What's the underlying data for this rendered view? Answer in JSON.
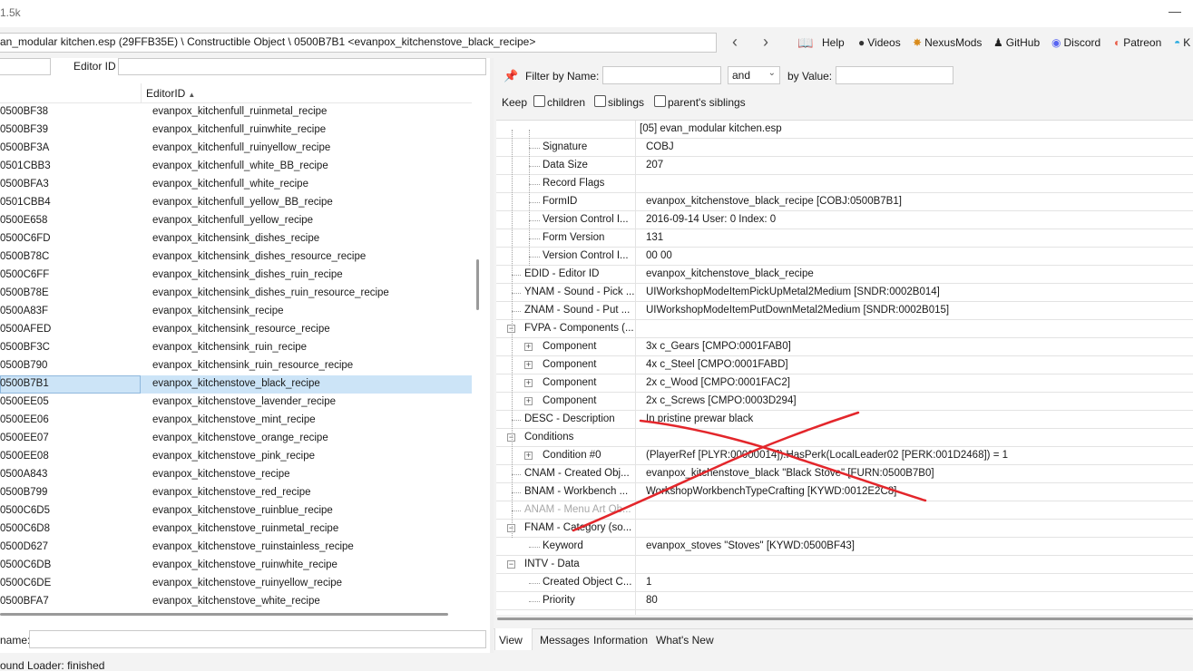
{
  "titlebar": {
    "title": "1.5k",
    "minimize": "—"
  },
  "path": {
    "text": "an_modular kitchen.esp (29FFB35E) \\ Constructible Object \\ 0500B7B1 <evanpox_kitchenstove_black_recipe>"
  },
  "nav": {
    "back": "‹",
    "forward": "›"
  },
  "toolbar_links": [
    {
      "label": "Help",
      "icon": "book-icon",
      "glyph": "📖"
    },
    {
      "label": "Videos",
      "icon": "videos-icon",
      "glyph": "●"
    },
    {
      "label": "NexusMods",
      "icon": "nexusmods-icon",
      "glyph": "✸"
    },
    {
      "label": "GitHub",
      "icon": "github-icon",
      "glyph": "♟"
    },
    {
      "label": "Discord",
      "icon": "discord-icon",
      "glyph": "◉"
    },
    {
      "label": "Patreon",
      "icon": "patreon-icon",
      "glyph": "◐"
    },
    {
      "label": "K",
      "icon": "kofi-icon",
      "glyph": "◓"
    }
  ],
  "left": {
    "editor_id_label": "Editor ID",
    "column_editor_id": "EditorID",
    "name_label": "name:",
    "rows": [
      {
        "formid": "0500BF38",
        "editorid": "evanpox_kitchenfull_ruinmetal_recipe"
      },
      {
        "formid": "0500BF39",
        "editorid": "evanpox_kitchenfull_ruinwhite_recipe"
      },
      {
        "formid": "0500BF3A",
        "editorid": "evanpox_kitchenfull_ruinyellow_recipe"
      },
      {
        "formid": "0501CBB3",
        "editorid": "evanpox_kitchenfull_white_BB_recipe"
      },
      {
        "formid": "0500BFA3",
        "editorid": "evanpox_kitchenfull_white_recipe"
      },
      {
        "formid": "0501CBB4",
        "editorid": "evanpox_kitchenfull_yellow_BB_recipe"
      },
      {
        "formid": "0500E658",
        "editorid": "evanpox_kitchenfull_yellow_recipe"
      },
      {
        "formid": "0500C6FD",
        "editorid": "evanpox_kitchensink_dishes_recipe"
      },
      {
        "formid": "0500B78C",
        "editorid": "evanpox_kitchensink_dishes_resource_recipe"
      },
      {
        "formid": "0500C6FF",
        "editorid": "evanpox_kitchensink_dishes_ruin_recipe"
      },
      {
        "formid": "0500B78E",
        "editorid": "evanpox_kitchensink_dishes_ruin_resource_recipe"
      },
      {
        "formid": "0500A83F",
        "editorid": "evanpox_kitchensink_recipe"
      },
      {
        "formid": "0500AFED",
        "editorid": "evanpox_kitchensink_resource_recipe"
      },
      {
        "formid": "0500BF3C",
        "editorid": "evanpox_kitchensink_ruin_recipe"
      },
      {
        "formid": "0500B790",
        "editorid": "evanpox_kitchensink_ruin_resource_recipe"
      },
      {
        "formid": "0500B7B1",
        "editorid": "evanpox_kitchenstove_black_recipe",
        "selected": true
      },
      {
        "formid": "0500EE05",
        "editorid": "evanpox_kitchenstove_lavender_recipe"
      },
      {
        "formid": "0500EE06",
        "editorid": "evanpox_kitchenstove_mint_recipe"
      },
      {
        "formid": "0500EE07",
        "editorid": "evanpox_kitchenstove_orange_recipe"
      },
      {
        "formid": "0500EE08",
        "editorid": "evanpox_kitchenstove_pink_recipe"
      },
      {
        "formid": "0500A843",
        "editorid": "evanpox_kitchenstove_recipe"
      },
      {
        "formid": "0500B799",
        "editorid": "evanpox_kitchenstove_red_recipe"
      },
      {
        "formid": "0500C6D5",
        "editorid": "evanpox_kitchenstove_ruinblue_recipe"
      },
      {
        "formid": "0500C6D8",
        "editorid": "evanpox_kitchenstove_ruinmetal_recipe"
      },
      {
        "formid": "0500D627",
        "editorid": "evanpox_kitchenstove_ruinstainless_recipe"
      },
      {
        "formid": "0500C6DB",
        "editorid": "evanpox_kitchenstove_ruinwhite_recipe"
      },
      {
        "formid": "0500C6DE",
        "editorid": "evanpox_kitchenstove_ruinyellow_recipe"
      },
      {
        "formid": "0500BFA7",
        "editorid": "evanpox_kitchenstove_white_recipe"
      }
    ]
  },
  "right": {
    "filter_by_name_label": "Filter by Name:",
    "and_option": "and",
    "by_value_label": "by Value:",
    "keep_label": "Keep",
    "children_label": "children",
    "siblings_label": "siblings",
    "parents_siblings_label": "parent's siblings",
    "header_value": "[05] evan_modular kitchen.esp",
    "rows": [
      {
        "label": "Signature",
        "value": "COBJ",
        "depth": 2
      },
      {
        "label": "Data Size",
        "value": "207",
        "depth": 2
      },
      {
        "label": "Record Flags",
        "value": "",
        "depth": 2
      },
      {
        "label": "FormID",
        "value": "evanpox_kitchenstove_black_recipe [COBJ:0500B7B1]",
        "depth": 2
      },
      {
        "label": "Version Control I...",
        "value": "2016-09-14 User: 0 Index: 0",
        "depth": 2
      },
      {
        "label": "Form Version",
        "value": "131",
        "depth": 2
      },
      {
        "label": "Version Control I...",
        "value": "00 00",
        "depth": 2
      },
      {
        "label": "EDID - Editor ID",
        "value": "evanpox_kitchenstove_black_recipe",
        "depth": 1
      },
      {
        "label": "YNAM - Sound - Pick ...",
        "value": "UIWorkshopModeItemPickUpMetal2Medium [SNDR:0002B014]",
        "depth": 1
      },
      {
        "label": "ZNAM - Sound - Put ...",
        "value": "UIWorkshopModeItemPutDownMetal2Medium [SNDR:0002B015]",
        "depth": 1
      },
      {
        "label": "FVPA - Components (...",
        "value": "",
        "depth": 1,
        "expander": "−"
      },
      {
        "label": "Component",
        "value": "3x c_Gears [CMPO:0001FAB0]",
        "depth": 2,
        "expander": "+"
      },
      {
        "label": "Component",
        "value": "4x c_Steel [CMPO:0001FABD]",
        "depth": 2,
        "expander": "+"
      },
      {
        "label": "Component",
        "value": "2x c_Wood [CMPO:0001FAC2]",
        "depth": 2,
        "expander": "+"
      },
      {
        "label": "Component",
        "value": "2x c_Screws [CMPO:0003D294]",
        "depth": 2,
        "expander": "+"
      },
      {
        "label": "DESC - Description",
        "value": "In pristine prewar black",
        "depth": 1
      },
      {
        "label": "Conditions",
        "value": "",
        "depth": 1,
        "expander": "−"
      },
      {
        "label": "Condition #0",
        "value": "(PlayerRef [PLYR:00000014]).HasPerk(LocalLeader02 [PERK:001D2468]) = 1",
        "depth": 2,
        "expander": "+"
      },
      {
        "label": "CNAM - Created Obj...",
        "value": "evanpox_kitchenstove_black \"Black Stove\" [FURN:0500B7B0]",
        "depth": 1
      },
      {
        "label": "BNAM - Workbench ...",
        "value": "WorkshopWorkbenchTypeCrafting [KYWD:0012E2C8]",
        "depth": 1
      },
      {
        "label": "ANAM - Menu Art Ob...",
        "value": "",
        "depth": 1,
        "disabled": true
      },
      {
        "label": "FNAM - Category (so...",
        "value": "",
        "depth": 1,
        "expander": "−"
      },
      {
        "label": "Keyword",
        "value": "evanpox_stoves \"Stoves\" [KYWD:0500BF43]",
        "depth": 2
      },
      {
        "label": "INTV - Data",
        "value": "",
        "depth": 1,
        "expander": "−"
      },
      {
        "label": "Created Object C...",
        "value": "1",
        "depth": 2
      },
      {
        "label": "Priority",
        "value": "80",
        "depth": 2
      }
    ],
    "tabs": [
      "View",
      "Messages",
      "Information",
      "What's New"
    ]
  },
  "status": {
    "text": "ound Loader: finished"
  },
  "colors": {
    "selection": "#cce4f7",
    "annotation_red": "#e3262b"
  }
}
